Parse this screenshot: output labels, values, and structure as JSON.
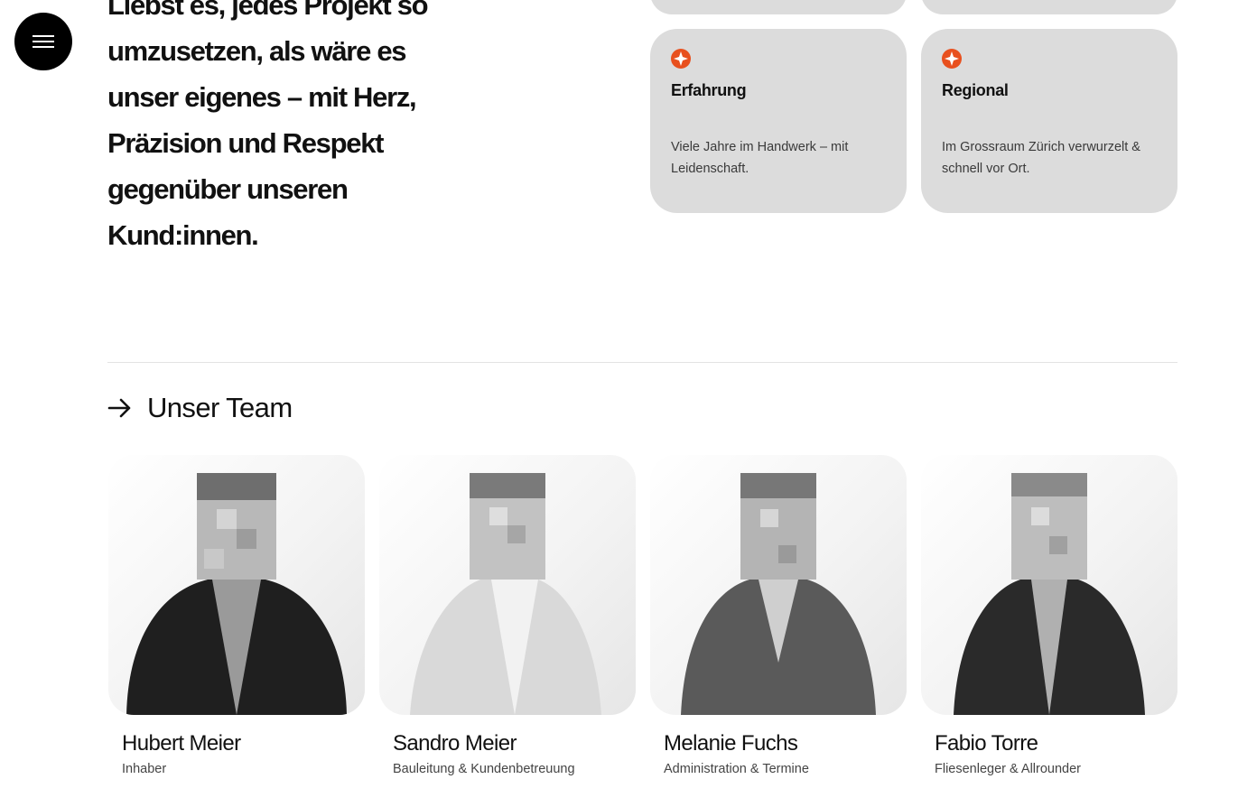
{
  "nav": {
    "menu_icon": "hamburger-menu-icon"
  },
  "intro": {
    "lines": [
      "Liebst es, jedes Projekt so",
      "umzusetzen, als wäre es",
      "unser eigenes – mit Herz,",
      "Präzision und Respekt",
      "gegenüber unseren",
      "Kund:innen."
    ]
  },
  "features": {
    "accent_color": "#e8501e",
    "icon": "compass-star-icon",
    "items": [
      {
        "title": "Erfahrung",
        "desc": "Viele Jahre im Handwerk – mit Leidenschaft."
      },
      {
        "title": "Regional",
        "desc": "Im Grossraum Zürich verwurzelt & schnell vor Ort."
      }
    ]
  },
  "team": {
    "heading": "Unser Team",
    "heading_icon": "arrow-right-icon",
    "members": [
      {
        "name": "Hubert Meier",
        "role": "Inhaber",
        "jacket": "dark"
      },
      {
        "name": "Sandro Meier",
        "role": "Bauleitung & Kundenbetreuung",
        "jacket": "light"
      },
      {
        "name": "Melanie Fuchs",
        "role": "Administration & Termine",
        "jacket": "grey"
      },
      {
        "name": "Fabio Torre",
        "role": "Fliesenleger & Allrounder",
        "jacket": "dark"
      }
    ]
  }
}
